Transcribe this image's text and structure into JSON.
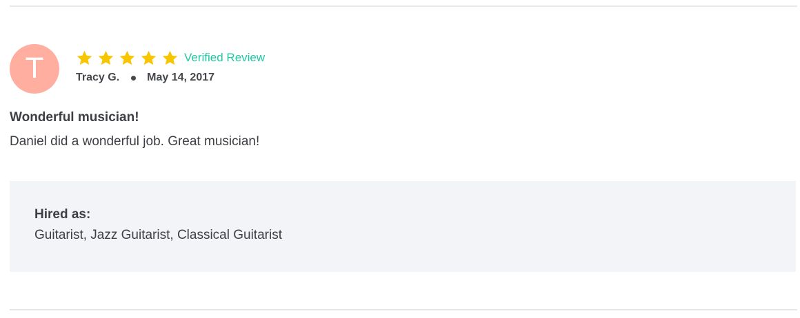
{
  "avatar": {
    "initial": "T",
    "color": "#ffaea0"
  },
  "rating": {
    "value": 5,
    "max": 5,
    "star_color": "#f7c600"
  },
  "verified_label": "Verified Review",
  "verified_color": "#1fc9a4",
  "author": "Tracy G.",
  "date": "May 14, 2017",
  "review": {
    "title": "Wonderful musician!",
    "body": "Daniel did a wonderful job. Great musician!"
  },
  "hired": {
    "label": "Hired as:",
    "value": "Guitarist, Jazz Guitarist, Classical Guitarist"
  },
  "icons": {
    "star": "star-icon",
    "separator": "dot-separator"
  }
}
